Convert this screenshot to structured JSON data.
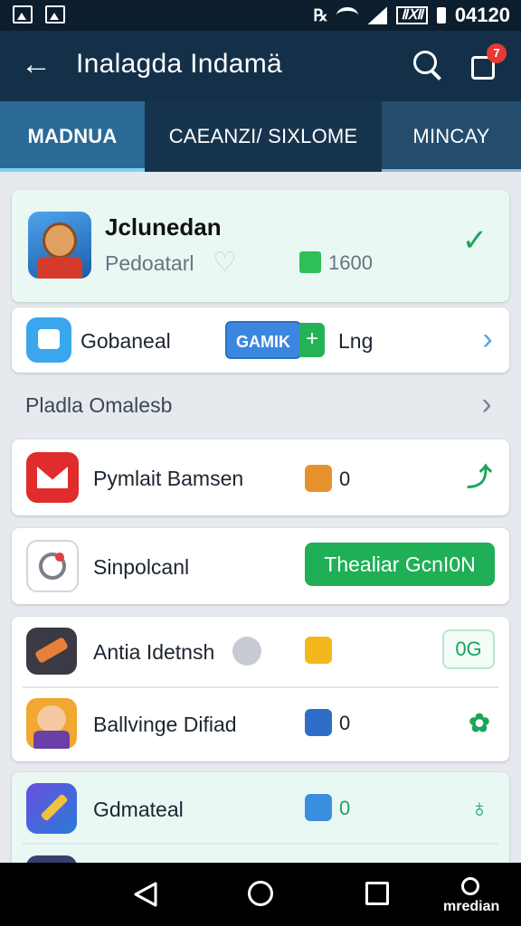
{
  "status_bar": {
    "time": "04120",
    "indicator": "ⅡⅫ",
    "nfc": "℞"
  },
  "app_bar": {
    "title": "Inalagda Indamä",
    "notification_count": "7"
  },
  "tabs": [
    {
      "label": "MADNUA"
    },
    {
      "label": "CAEANZI/ SIXLOME"
    },
    {
      "label": "MINCAY"
    }
  ],
  "profile": {
    "name": "Jclunedan",
    "subtitle": "Pedoatarl",
    "count": "1600"
  },
  "game_row": {
    "label": "Gobaneal",
    "button": "GAMIK",
    "plus": "+",
    "suffix": "Lng"
  },
  "section": {
    "title": "Pladla Omalesb"
  },
  "list": [
    {
      "label": "Pymlait Bamsen",
      "count": "0"
    },
    {
      "label": "Sinpolcanl",
      "action": "Thealiar GcnI0N"
    },
    {
      "label": "Antia Idetnsh",
      "action": "0G"
    },
    {
      "label": "Ballvinge Difiad",
      "count": "0"
    },
    {
      "label": "Gdmateal",
      "count": "0"
    }
  ],
  "nav_bar": {
    "extra_label": "mredian"
  },
  "colors": {
    "app_bar": "#143049",
    "tab_active": "#2a6a95",
    "accent_green": "#1faf56",
    "accent_blue": "#3b87e0"
  }
}
